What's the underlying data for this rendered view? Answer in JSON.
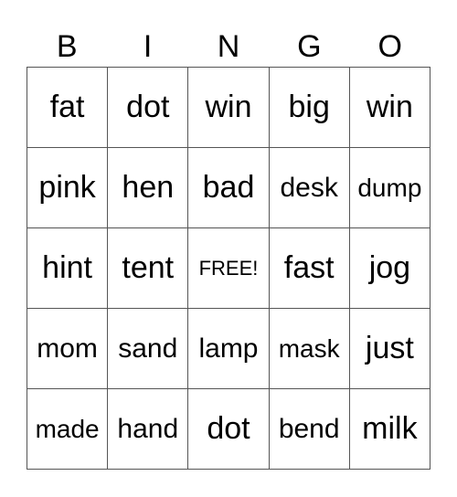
{
  "header": [
    "B",
    "I",
    "N",
    "G",
    "O"
  ],
  "rows": [
    [
      "fat",
      "dot",
      "win",
      "big",
      "win"
    ],
    [
      "pink",
      "hen",
      "bad",
      "desk",
      "dump"
    ],
    [
      "hint",
      "tent",
      "FREE!",
      "fast",
      "jog"
    ],
    [
      "mom",
      "sand",
      "lamp",
      "mask",
      "just"
    ],
    [
      "made",
      "hand",
      "dot",
      "bend",
      "milk"
    ]
  ]
}
